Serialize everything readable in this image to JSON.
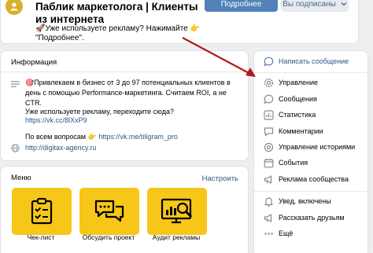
{
  "header": {
    "title": "Паблик маркетолога | Клиенты из интернета",
    "status": "🚀Уже используете рекламу? Нажимайте 👉 \"Подробнее\".",
    "btn_more": "Подробнее",
    "btn_subscribed": "Вы подписаны"
  },
  "info": {
    "title": "Информация",
    "line1": "🎯Привлекаем в бизнес от 3 до 97 потенциальных клиентов в день с помощью Performance-маркетинга. Считаем ROI, а не CTR.",
    "line2": "Уже используете рекламу, переходите сюда?",
    "link1": "https://vk.cc/8lXxP9",
    "line3_prefix": "По всем вопросам 👉",
    "link2": "https://vk.me/tiligram_pro",
    "site": "http://digitax-agency.ru"
  },
  "menu": {
    "title": "Меню",
    "setup": "Настроить",
    "tiles": [
      {
        "label": "Чек-лист",
        "icon": "checklist-icon"
      },
      {
        "label": "Обсудить проект",
        "icon": "chat-icon"
      },
      {
        "label": "Аудит рекламы",
        "icon": "monitor-search-icon"
      }
    ]
  },
  "side": {
    "items": [
      {
        "label": "Написать сообщение",
        "icon": "message-icon",
        "accent": true
      },
      {
        "label": "Управление",
        "icon": "gear-icon"
      },
      {
        "label": "Сообщения",
        "icon": "message-icon"
      },
      {
        "label": "Статистика",
        "icon": "stats-icon"
      },
      {
        "label": "Комментарии",
        "icon": "comment-icon"
      },
      {
        "label": "Управление историями",
        "icon": "stories-icon"
      },
      {
        "label": "События",
        "icon": "calendar-icon"
      },
      {
        "label": "Реклама сообщества",
        "icon": "megaphone-icon"
      },
      {
        "label": "Увед. включены",
        "icon": "bell-icon"
      },
      {
        "label": "Рассказать друзьям",
        "icon": "megaphone-icon"
      },
      {
        "label": "Ещё",
        "icon": "more-icon"
      }
    ]
  },
  "colors": {
    "accent": "#5181b8",
    "link": "#2a5885",
    "tile_yellow": "#f6c619",
    "arrow": "#b0191e"
  }
}
